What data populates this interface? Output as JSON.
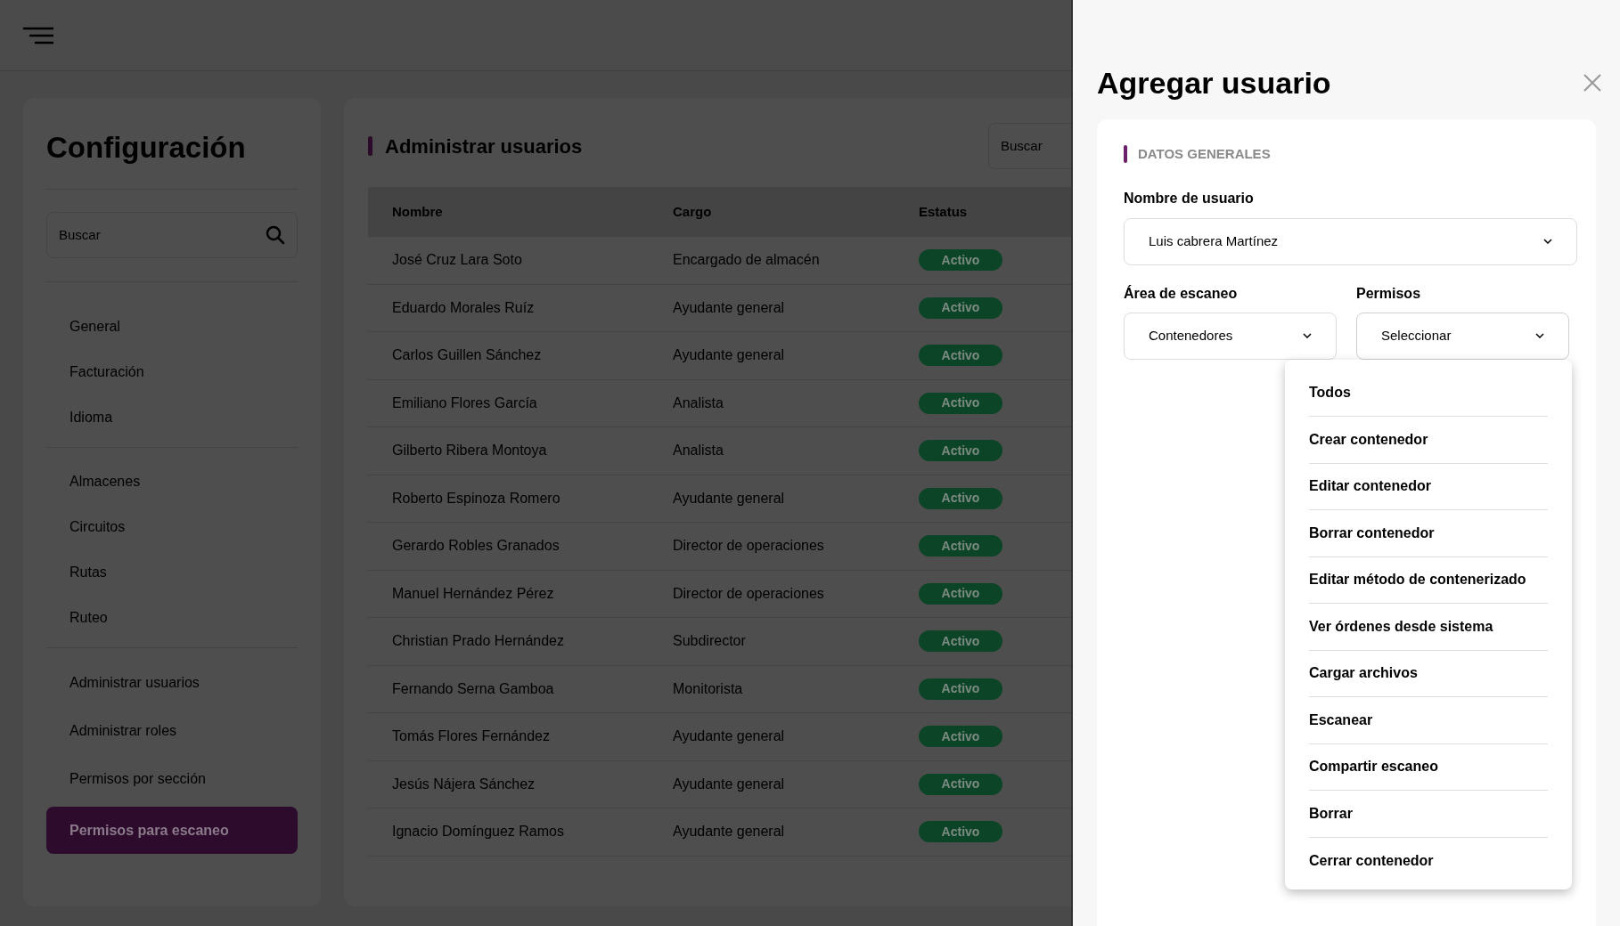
{
  "sidebar": {
    "title": "Configuración",
    "search": {
      "placeholder": "Buscar"
    },
    "groups": [
      [
        {
          "label": "General",
          "selected": false
        },
        {
          "label": "Facturación",
          "selected": false
        },
        {
          "label": "Idioma",
          "selected": false
        }
      ],
      [
        {
          "label": "Almacenes",
          "selected": false
        },
        {
          "label": "Circuitos",
          "selected": false
        },
        {
          "label": "Rutas",
          "selected": false
        },
        {
          "label": "Ruteo",
          "selected": false
        }
      ],
      [
        {
          "label": "Administrar usuarios",
          "selected": false
        },
        {
          "label": "Administrar roles",
          "selected": false
        },
        {
          "label": "Permisos por sección",
          "selected": false
        },
        {
          "label": "Permisos para escaneo",
          "selected": true
        }
      ]
    ]
  },
  "main": {
    "title": "Administrar usuarios",
    "search": {
      "placeholder": "Buscar"
    },
    "table": {
      "columns": [
        "Nombre",
        "Cargo",
        "Estatus"
      ],
      "rows": [
        {
          "name": "José Cruz Lara Soto",
          "role": "Encargado de almacén",
          "status": "Activo"
        },
        {
          "name": "Eduardo Morales Ruíz",
          "role": "Ayudante general",
          "status": "Activo"
        },
        {
          "name": "Carlos Guillen Sánchez",
          "role": "Ayudante general",
          "status": "Activo"
        },
        {
          "name": "Emiliano Flores García",
          "role": "Analista",
          "status": "Activo"
        },
        {
          "name": "Gilberto Ribera Montoya",
          "role": "Analista",
          "status": "Activo"
        },
        {
          "name": "Roberto Espinoza Romero",
          "role": "Ayudante general",
          "status": "Activo"
        },
        {
          "name": "Gerardo Robles Granados",
          "role": "Director de operaciones",
          "status": "Activo"
        },
        {
          "name": "Manuel Hernández Pérez",
          "role": "Director de operaciones",
          "status": "Activo"
        },
        {
          "name": "Christian Prado Hernández",
          "role": "Subdirector",
          "status": "Activo"
        },
        {
          "name": "Fernando Serna Gamboa",
          "role": "Monitorista",
          "status": "Activo"
        },
        {
          "name": "Tomás Flores Fernández",
          "role": "Ayudante general",
          "status": "Activo"
        },
        {
          "name": "Jesús Nájera Sánchez",
          "role": "Ayudante general",
          "status": "Activo"
        },
        {
          "name": "Ignacio Domínguez Ramos",
          "role": "Ayudante general",
          "status": "Activo"
        }
      ]
    }
  },
  "drawer": {
    "title": "Agregar usuario",
    "section": "DATOS GENERALES",
    "user_field": {
      "label": "Nombre de usuario",
      "value": "Luis cabrera Martínez"
    },
    "area_field": {
      "label": "Área de escaneo",
      "value": "Contenedores"
    },
    "permissions_field": {
      "label": "Permisos",
      "value": "Seleccionar",
      "expanded": true
    },
    "permissions_options": [
      "Todos",
      "Crear contenedor",
      "Editar contenedor",
      "Borrar contenedor",
      "Editar método de contenerizado",
      "Ver órdenes desde sistema",
      "Cargar archivos",
      "Escanear",
      "Compartir escaneo",
      "Borrar",
      "Cerrar contenedor"
    ]
  }
}
